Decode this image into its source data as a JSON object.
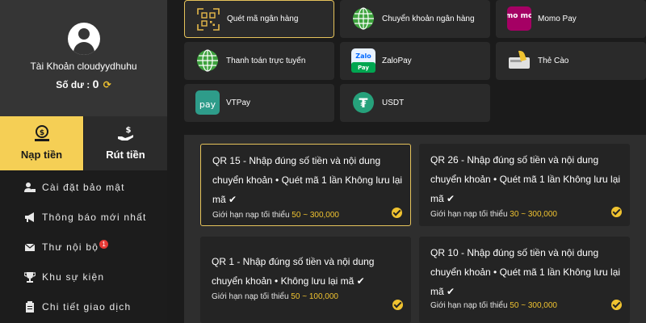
{
  "profile": {
    "account_label": "Tài Khoản cloudyydhuhu",
    "balance_label": "Số dư :",
    "balance_value": "0"
  },
  "tabs": {
    "deposit": "Nạp tiền",
    "withdraw": "Rút tiền"
  },
  "menu": [
    {
      "label": "Cài đặt bảo mật",
      "icon": "user-lock-icon"
    },
    {
      "label": "Thông báo mới nhất",
      "icon": "megaphone-icon"
    },
    {
      "label": "Thư nội bộ",
      "icon": "envelope-icon",
      "badge": "1"
    },
    {
      "label": "Khu sự kiện",
      "icon": "trophy-icon"
    },
    {
      "label": "Chi tiết giao dịch",
      "icon": "clipboard-icon"
    }
  ],
  "methods": [
    {
      "name": "Quét mã ngân hàng",
      "icon": "qr-code-icon",
      "active": true
    },
    {
      "name": "Chuyển khoản ngân hàng",
      "icon": "globe-icon"
    },
    {
      "name": "Momo Pay",
      "icon": "momo-icon",
      "logo_text": "mo mo"
    },
    {
      "name": "Thanh toán trực tuyến",
      "icon": "globe-icon"
    },
    {
      "name": "ZaloPay",
      "icon": "zalopay-icon",
      "logo_text": "Zalo Pay"
    },
    {
      "name": "Thẻ Cào",
      "icon": "scratch-card-icon"
    },
    {
      "name": "VTPay",
      "icon": "vtpay-icon",
      "logo_text": "pay"
    },
    {
      "name": "USDT",
      "icon": "tether-icon",
      "logo_text": "₮"
    }
  ],
  "limit_label": "Giới hạn nạp tối thiểu",
  "options": [
    {
      "title": "QR 15 - Nhập đúng số tiền và nội dung chuyển khoản • Quét mã 1 lần Không lưu lại mã ✔",
      "range": "50 ~ 300,000",
      "selected": true
    },
    {
      "title": "QR 26 - Nhập đúng số tiền và nội dung chuyển khoản • Quét mã 1 lần Không lưu lại mã ✔",
      "range": "30 ~ 300,000"
    },
    {
      "title": "QR 1 - Nhập đúng số tiền và nội dung chuyển khoản • Không lưu lại mã ✔",
      "range": "50 ~ 100,000"
    },
    {
      "title": "QR 10 - Nhập đúng số tiền và nội dung chuyển khoản • Quét mã 1 lần Không lưu lại mã ✔",
      "range": "50 ~ 300,000"
    }
  ],
  "colors": {
    "accent": "#f5cf55",
    "highlight": "#f0c330",
    "momo": "#a50064",
    "zalopay": "#0068ff",
    "vtpay": "#2e9c8a",
    "tether": "#26a17b",
    "globe": "#3ea33e"
  }
}
